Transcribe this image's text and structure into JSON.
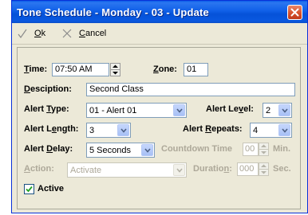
{
  "window": {
    "title": "Tone Schedule - Monday - 03 - Update",
    "accent_color": "#0a5ce8",
    "close_icon": "close-icon"
  },
  "toolbar": {
    "ok_label": "Ok",
    "cancel_label": "Cancel"
  },
  "form": {
    "time": {
      "label": "Time:",
      "value": "07:50 AM"
    },
    "zone": {
      "label": "Zone:",
      "value": "01"
    },
    "description": {
      "label": "Desciption:",
      "value": "Second Class"
    },
    "alert_type": {
      "label": "Alert Type:",
      "value": "01 - Alert 01"
    },
    "alert_level": {
      "label": "Alert Level:",
      "value": "2"
    },
    "alert_length": {
      "label": "Alert Length:",
      "value": "3"
    },
    "alert_repeats": {
      "label": "Alert Repeats:",
      "value": "4"
    },
    "alert_delay": {
      "label": "Alert Delay:",
      "value": "5 Seconds"
    },
    "countdown_time": {
      "label": "Countdown Time",
      "value": "00",
      "unit": "Min."
    },
    "action": {
      "label": "Action:",
      "value": "Activate"
    },
    "duration": {
      "label": "Duration:",
      "value": "000",
      "unit": "Sec."
    },
    "active": {
      "label": "Active",
      "checked": true
    }
  }
}
